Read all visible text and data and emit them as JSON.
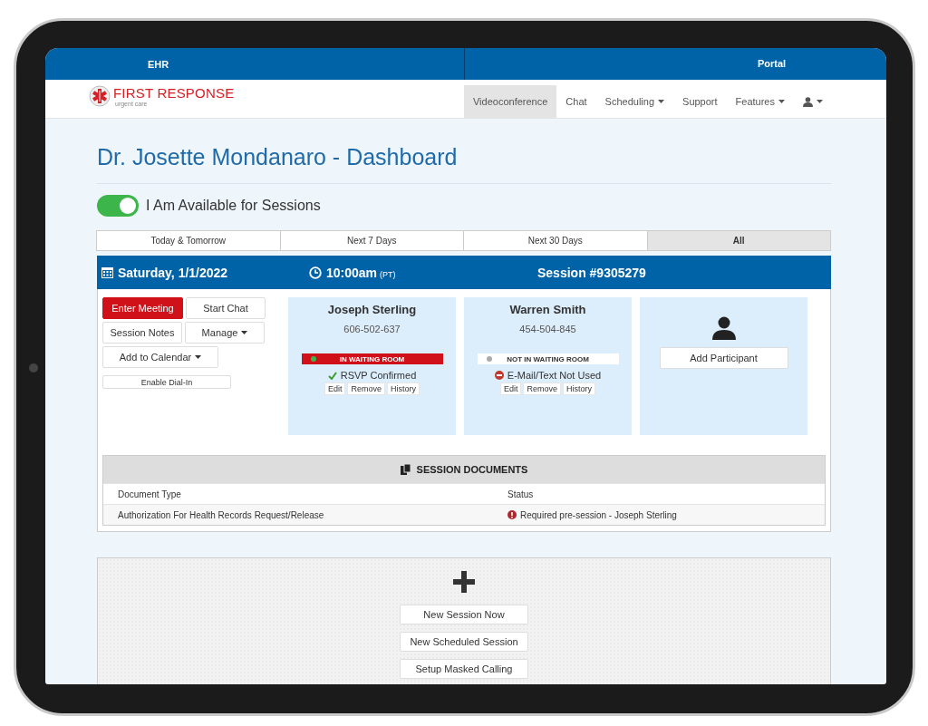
{
  "top_bar": {
    "left": "EHR",
    "right": "Portal"
  },
  "brand": {
    "name": "FIRST RESPONSE",
    "tagline": "urgent care"
  },
  "nav": [
    {
      "label": "Videoconference",
      "selected": true,
      "dropdown": false
    },
    {
      "label": "Chat",
      "selected": false,
      "dropdown": false
    },
    {
      "label": "Scheduling",
      "selected": false,
      "dropdown": true
    },
    {
      "label": "Support",
      "selected": false,
      "dropdown": false
    },
    {
      "label": "Features",
      "selected": false,
      "dropdown": true
    }
  ],
  "title": "Dr. Josette Mondanaro - Dashboard",
  "availability": {
    "label": "I Am Available for Sessions",
    "on": true
  },
  "range_tabs": [
    {
      "label": "Today & Tomorrow",
      "selected": false
    },
    {
      "label": "Next 7 Days",
      "selected": false
    },
    {
      "label": "Next 30 Days",
      "selected": false
    },
    {
      "label": "All",
      "selected": true
    }
  ],
  "session": {
    "date": "Saturday, 1/1/2022",
    "time": "10:00am",
    "timezone": "(PT)",
    "number": "Session #9305279",
    "action_rows": [
      [
        {
          "label": "Enter Meeting",
          "kind": "primary",
          "dropdown": false
        },
        {
          "label": "Start Chat",
          "kind": "normal",
          "dropdown": false
        }
      ],
      [
        {
          "label": "Session Notes",
          "kind": "normal",
          "dropdown": false
        },
        {
          "label": "Manage",
          "kind": "normal",
          "dropdown": true
        }
      ],
      [
        {
          "label": "Add to Calendar",
          "kind": "wide",
          "dropdown": true
        }
      ],
      [
        {
          "label": "Enable Dial-In",
          "kind": "small",
          "dropdown": false
        }
      ]
    ],
    "participants": [
      {
        "name": "Joseph Sterling",
        "phone": "606-502-637",
        "in_waiting_room": true,
        "room_label": "IN WAITING ROOM",
        "contact": {
          "kind": "confirmed",
          "label": "RSVP Confirmed"
        },
        "links": [
          "Edit",
          "Remove",
          "History"
        ]
      },
      {
        "name": "Warren Smith",
        "phone": "454-504-845",
        "in_waiting_room": false,
        "room_label": "NOT IN WAITING ROOM",
        "contact": {
          "kind": "unused",
          "label": "E-Mail/Text Not Used"
        },
        "links": [
          "Edit",
          "Remove",
          "History"
        ]
      }
    ],
    "add_participant": "Add Participant",
    "documents": {
      "title": "SESSION DOCUMENTS",
      "columns": [
        "Document Type",
        "Status"
      ],
      "rows": [
        {
          "type": "Authorization For Health Records Request/Release",
          "status": "Required pre-session - Joseph Sterling",
          "kind": "required"
        }
      ]
    }
  },
  "new_session": {
    "buttons": [
      "New Session Now",
      "New Scheduled Session",
      "Setup Masked Calling"
    ]
  }
}
